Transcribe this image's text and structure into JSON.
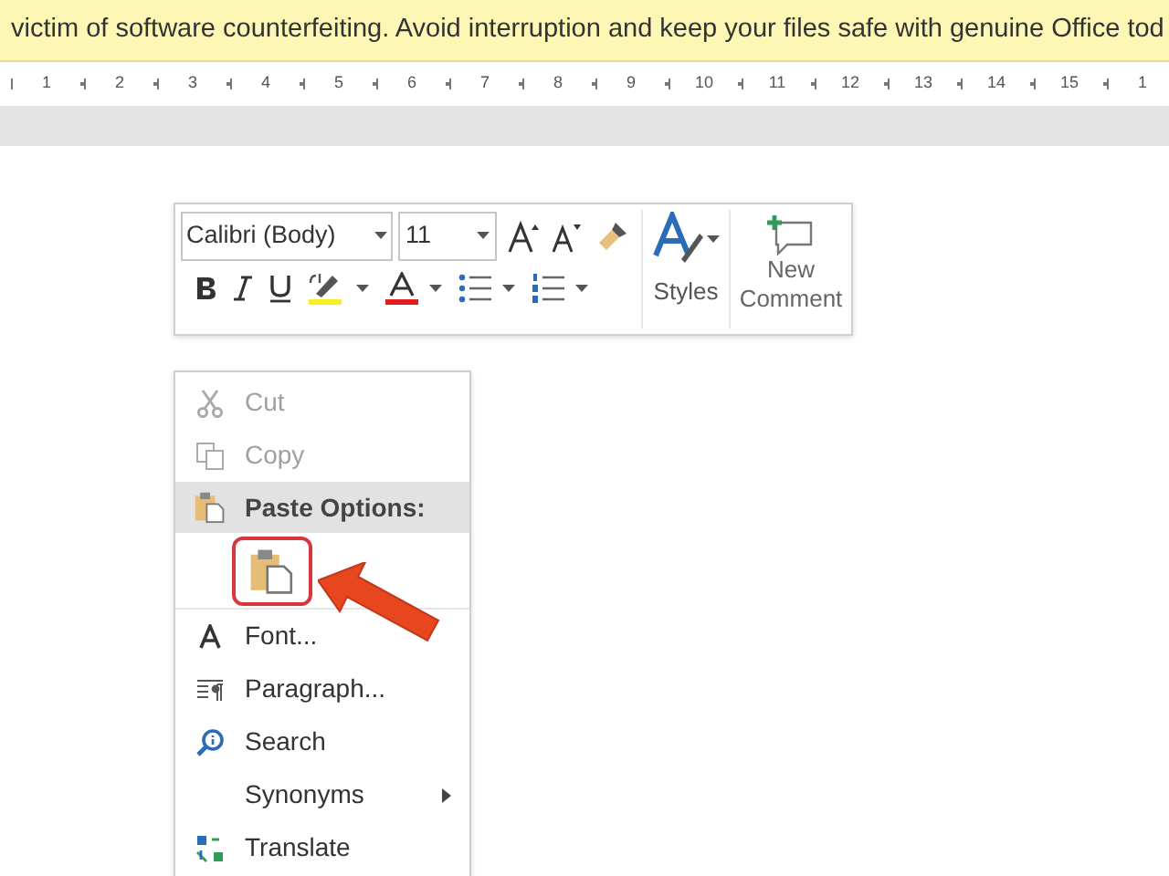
{
  "banner": {
    "text": "victim of software counterfeiting. Avoid interruption and keep your files safe with genuine Office tod"
  },
  "ruler": {
    "numbers": [
      "1",
      "2",
      "3",
      "4",
      "5",
      "6",
      "7",
      "8",
      "9",
      "10",
      "11",
      "12",
      "13",
      "14",
      "15",
      "1"
    ]
  },
  "mini_toolbar": {
    "font": "Calibri (Body)",
    "size": "11",
    "styles_label": "Styles",
    "comment_label_1": "New",
    "comment_label_2": "Comment"
  },
  "context_menu": {
    "items": [
      {
        "kind": "item",
        "label": "Cut",
        "disabled": true,
        "highlighted": false,
        "submenu": false
      },
      {
        "kind": "item",
        "label": "Copy",
        "disabled": true,
        "highlighted": false,
        "submenu": false
      },
      {
        "kind": "header",
        "label": "Paste Options:",
        "highlighted": true
      },
      {
        "kind": "paste_options",
        "options": [
          {
            "selected": true
          }
        ]
      },
      {
        "kind": "item",
        "label": "Font...",
        "disabled": false,
        "highlighted": false,
        "submenu": false
      },
      {
        "kind": "item",
        "label": "Paragraph...",
        "disabled": false,
        "highlighted": false,
        "submenu": false
      },
      {
        "kind": "item",
        "label": "Search",
        "disabled": false,
        "highlighted": false,
        "submenu": false
      },
      {
        "kind": "item",
        "label": "Synonyms",
        "disabled": false,
        "highlighted": false,
        "submenu": true
      },
      {
        "kind": "item",
        "label": "Translate",
        "disabled": false,
        "highlighted": false,
        "submenu": false
      }
    ]
  }
}
